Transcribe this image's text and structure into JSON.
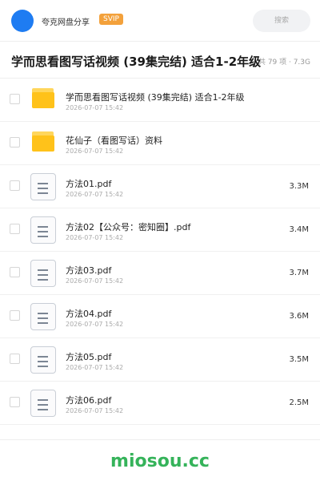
{
  "header": {
    "brand": "夸克网盘分享",
    "badge": "SVIP",
    "search_placeholder": "搜索"
  },
  "folder": {
    "title": "学而思看图写话视频 (39集完结) 适合1-2年级",
    "summary": "共 79 项 · 7.3G"
  },
  "items": [
    {
      "type": "folder",
      "name": "学而思看图写话视频 (39集完结) 适合1-2年级",
      "date": "2026-07-07 15:42",
      "size": ""
    },
    {
      "type": "folder",
      "name": "花仙子（看图写话）资料",
      "date": "2026-07-07 15:42",
      "size": ""
    },
    {
      "type": "file",
      "name": "方法01.pdf",
      "date": "2026-07-07 15:42",
      "size": "3.3M"
    },
    {
      "type": "file",
      "name": "方法02【公众号：密知圈】.pdf",
      "date": "2026-07-07 15:42",
      "size": "3.4M"
    },
    {
      "type": "file",
      "name": "方法03.pdf",
      "date": "2026-07-07 15:42",
      "size": "3.7M"
    },
    {
      "type": "file",
      "name": "方法04.pdf",
      "date": "2026-07-07 15:42",
      "size": "3.6M"
    },
    {
      "type": "file",
      "name": "方法05.pdf",
      "date": "2026-07-07 15:42",
      "size": "3.5M"
    },
    {
      "type": "file",
      "name": "方法06.pdf",
      "date": "2026-07-07 15:42",
      "size": "2.5M"
    }
  ],
  "watermark": "miosou.cc",
  "icons": {
    "folder": "folder-icon",
    "file": "pdf-file-icon",
    "avatar": "avatar"
  },
  "colors": {
    "accent": "#1e7cf2",
    "svip": "#f3a13b",
    "folder": "#ffc21a",
    "watermark": "#35b35a"
  }
}
